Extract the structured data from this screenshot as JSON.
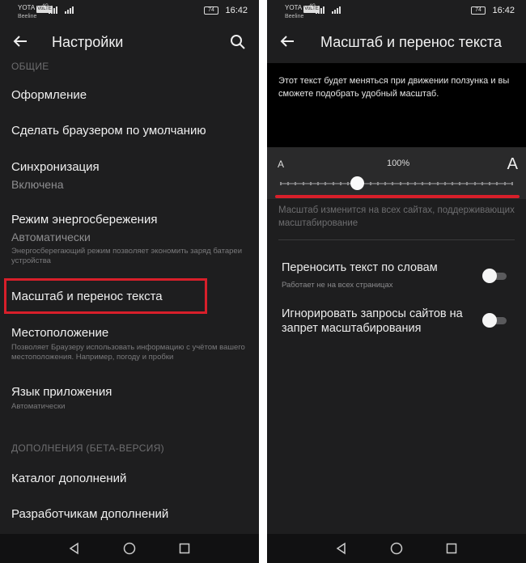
{
  "status_bar": {
    "carrier_line1": "YOTA",
    "volte": "VoLTE",
    "carrier_line2": "Beeline",
    "network": "4G",
    "battery": "74",
    "time": "16:42"
  },
  "left": {
    "title": "Настройки",
    "section_general": "ОБЩИЕ",
    "items": [
      {
        "title": "Оформление"
      },
      {
        "title": "Сделать браузером по умолчанию"
      },
      {
        "title": "Синхронизация",
        "value": "Включена"
      },
      {
        "title": "Режим энергосбережения",
        "value": "Автоматически",
        "desc": "Энергосберегающий режим позволяет экономить заряд батареи устройства"
      },
      {
        "title": "Масштаб и перенос текста"
      },
      {
        "title": "Местоположение",
        "desc": "Позволяет Браузеру использовать информацию с учётом вашего местоположения. Например, погоду и пробки"
      },
      {
        "title": "Язык приложения",
        "desc": "Автоматически"
      }
    ],
    "section_addons": "ДОПОЛНЕНИЯ (БЕТА-ВЕРСИЯ)",
    "addons": [
      {
        "title": "Каталог дополнений"
      },
      {
        "title": "Разработчикам дополнений"
      }
    ]
  },
  "right": {
    "title": "Масштаб и перенос текста",
    "preview_text": "Этот текст будет меняться при движении ползунка и вы сможете подобрать удобный масштаб.",
    "slider": {
      "min_label": "А",
      "max_label": "А",
      "value_label": "100%",
      "position": 0.33
    },
    "scale_note": "Масштаб изменится на всех сайтах, поддерживающих масштабирование",
    "options": [
      {
        "title": "Переносить текст по словам",
        "desc": "Работает не на всех страницах",
        "enabled": false
      },
      {
        "title": "Игнорировать запросы сайтов на запрет масштабирования",
        "enabled": false
      }
    ]
  },
  "colors": {
    "background": "#1e1e1f",
    "highlight": "#d81f2a",
    "preview_bg": "#000000",
    "text": "#f0f0f0",
    "secondary_text": "#8e8e90"
  }
}
